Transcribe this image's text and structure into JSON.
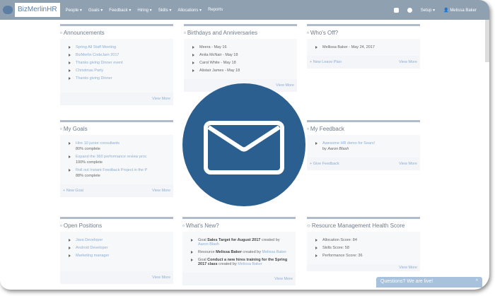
{
  "nav": {
    "brand": "BizMerlinHR",
    "menu": [
      "People ▾",
      "Goals ▾",
      "Feedback ▾",
      "Hiring ▾",
      "Skills ▾",
      "Allocations ▾",
      "Reports"
    ],
    "setup": "Setup ▾",
    "user": "Melissa Baker"
  },
  "announcements": {
    "title": "Announcements",
    "items": [
      "Spring All Staff Meeting",
      "BizMerlin CodeJam 2017",
      "Thanks giving Dinner event",
      "Christmas Party",
      "Thanks giving Dinner"
    ],
    "view_more": "View More"
  },
  "birthdays": {
    "title": "Birthdays and Anniversaries",
    "items": [
      "Meera - May 16",
      "Anita McNair - May 18",
      "Carol White - May 18",
      "Alistair James - May 18"
    ],
    "view_more": "View More"
  },
  "whos_off": {
    "title": "Who's Off?",
    "items": [
      "Mellissa Baker - May 24, 2017"
    ],
    "new_label": "+ New Leave Plan",
    "view_more": "View More"
  },
  "goals": {
    "title": "My Goals",
    "items": [
      {
        "name": "Hire 10 junior consultants",
        "progress": "80% complete"
      },
      {
        "name": "Expand the 360 performance review proc",
        "progress": "100% complete"
      },
      {
        "name": "Roll out Instant Feedback Project in the P",
        "progress": "88% complete"
      }
    ],
    "new_label": "+ New Goal",
    "view_more": "View More"
  },
  "feedback": {
    "title": "My Feedback",
    "item": "Awesome HR demo for Sears!",
    "by": "by",
    "author": "Aaron Blash",
    "new_label": "+ Give Feedback",
    "view_more": "View More"
  },
  "positions": {
    "title": "Open Positions",
    "items": [
      "Java Developer",
      "Android Developer",
      "Marketing manager"
    ],
    "view_more": "View More"
  },
  "whats_new": {
    "title": "What's New?",
    "items": [
      {
        "pre": "Goal ",
        "bold": "Sales Target for August 2017",
        "mid": " created by ",
        "link": "Aaron Blash"
      },
      {
        "pre": "Resource ",
        "bold": "Melissa Baker",
        "mid": " created by ",
        "link": "Melissa Baker"
      },
      {
        "pre": "Goal ",
        "bold": "Conduct a new hires training for the Spring 2017 class",
        "mid": " created by ",
        "link": "Melissa Baker"
      }
    ],
    "view_more": "View More"
  },
  "health": {
    "title": "Resource Management Health Score",
    "items": [
      "Allocation Score: 84",
      "Skills Score: 58",
      "Performance Score: 36"
    ],
    "view_more": "View More"
  },
  "chat": {
    "label": "Questions? We are live!",
    "chevron": "^"
  },
  "colors": {
    "nav": "#8fa0b0",
    "circle": "#2a5f8f",
    "link": "#8eaed3"
  }
}
